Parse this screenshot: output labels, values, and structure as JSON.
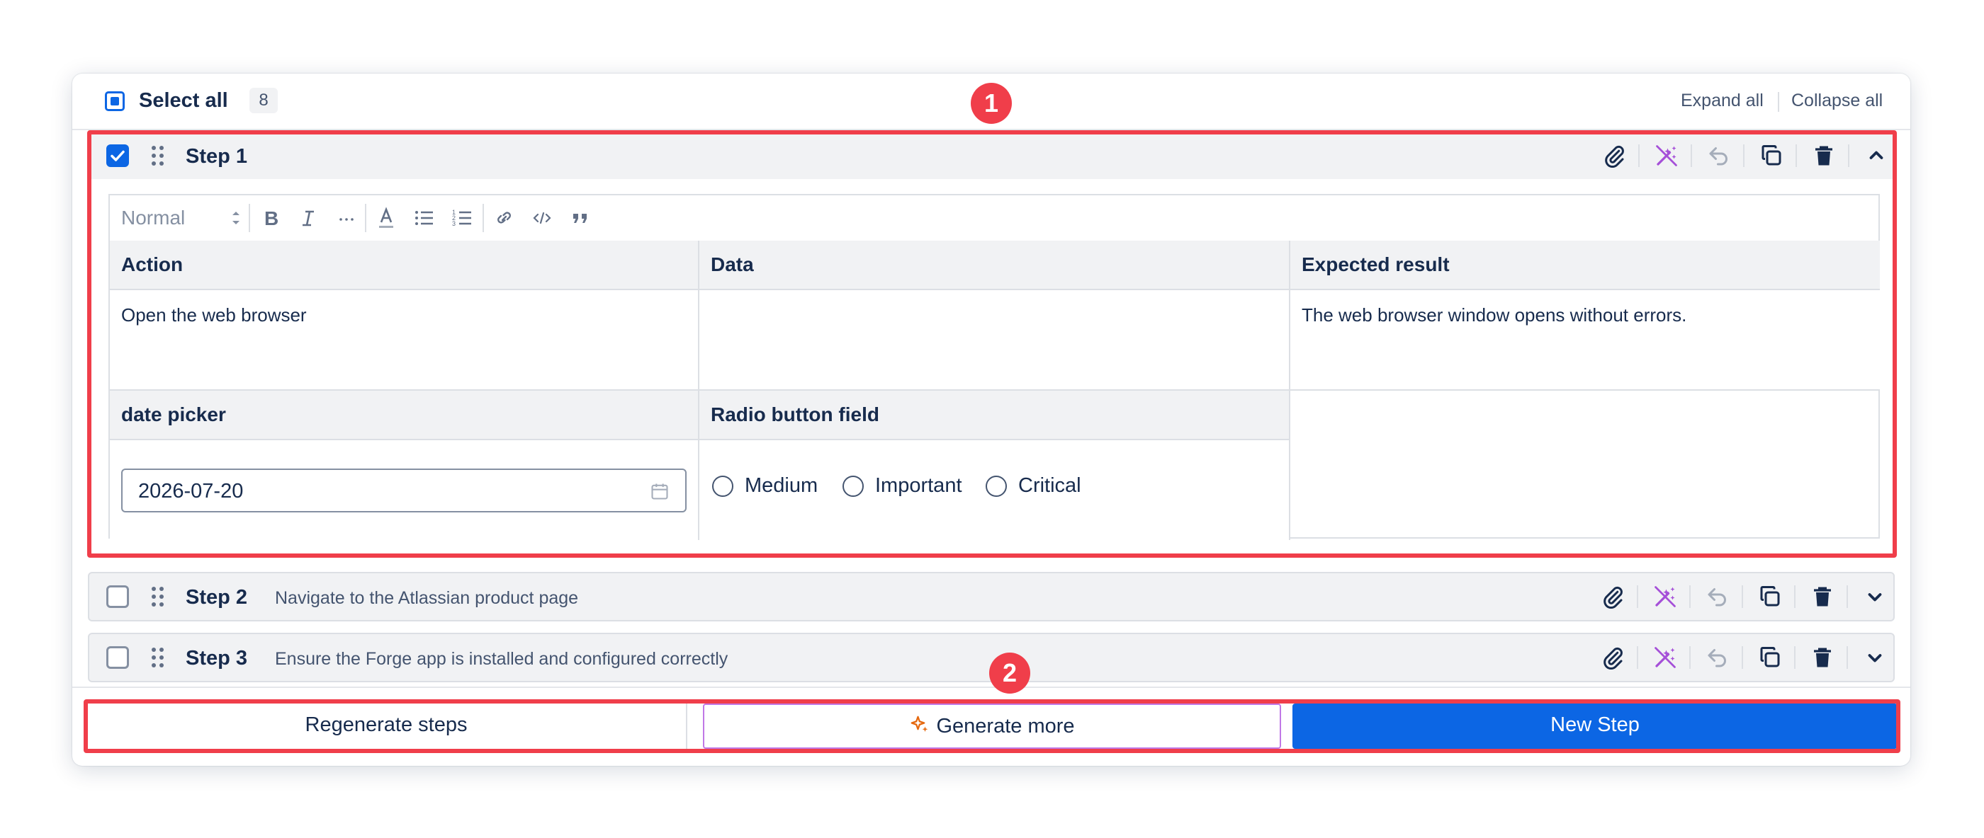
{
  "header": {
    "select_all_label": "Select all",
    "count": "8",
    "expand_all": "Expand all",
    "collapse_all": "Collapse all"
  },
  "steps": [
    {
      "title": "Step 1",
      "description": "",
      "checked": true,
      "expanded": true
    },
    {
      "title": "Step 2",
      "description": "Navigate to the Atlassian product page",
      "checked": false,
      "expanded": false
    },
    {
      "title": "Step 3",
      "description": "Ensure the Forge app is installed and configured correctly",
      "checked": false,
      "expanded": false
    }
  ],
  "editor": {
    "format_select": "Normal",
    "table": {
      "headers": [
        "Action",
        "Data",
        "Expected result"
      ],
      "row": [
        "Open the web browser",
        "",
        "The web browser window opens without errors."
      ]
    },
    "custom_fields": {
      "date_label": "date picker",
      "date_value": "2026-07-20",
      "radio_label": "Radio button field",
      "radio_options": [
        "Medium",
        "Important",
        "Critical"
      ]
    }
  },
  "footer": {
    "regenerate": "Regenerate steps",
    "generate_more": "Generate more",
    "new_step": "New Step"
  },
  "annotations": [
    "1",
    "2"
  ],
  "colors": {
    "primary": "#0c66e4",
    "annotation_red": "#f03e4a",
    "ai_purple": "#c078e6",
    "spark_orange": "#e56910"
  }
}
